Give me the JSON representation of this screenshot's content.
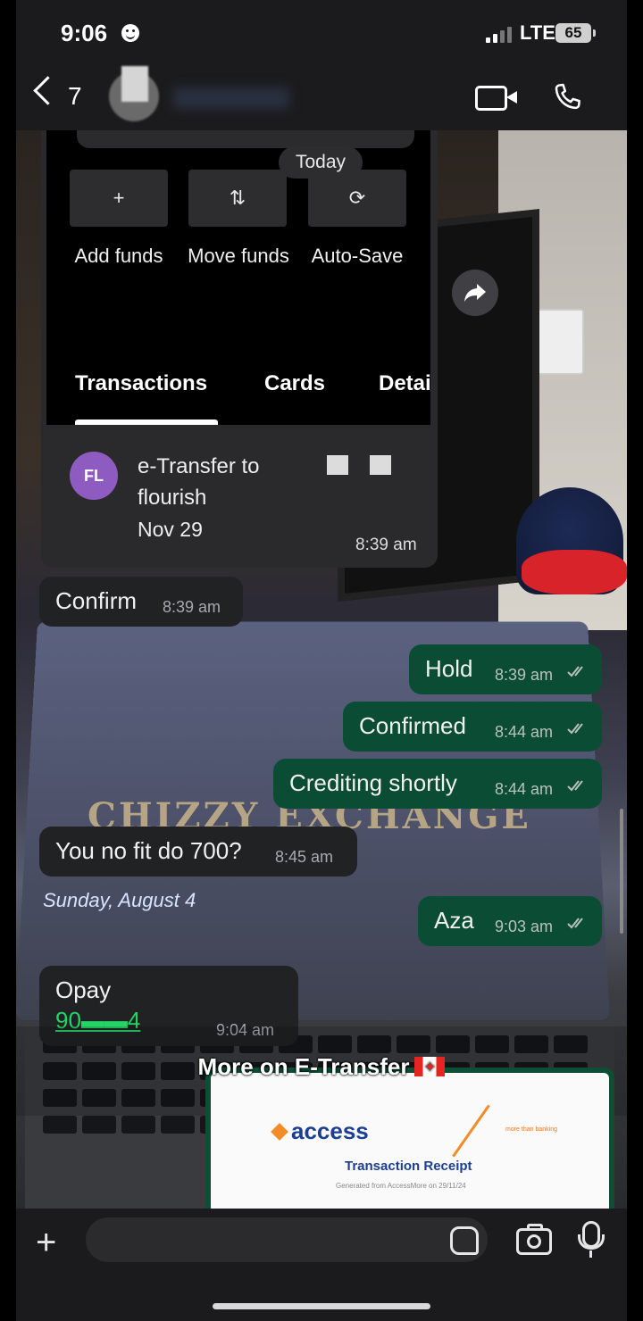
{
  "status_bar": {
    "time": "9:06",
    "network": "LTE",
    "battery": "65"
  },
  "header": {
    "back_count": "7"
  },
  "screenshot": {
    "quick_actions": [
      {
        "icon": "+",
        "label": "Add funds",
        "icon_name": "add-icon"
      },
      {
        "icon": "⇅",
        "label": "Move funds",
        "icon_name": "transfer-icon"
      },
      {
        "icon": "⟳",
        "label": "Auto-Save",
        "icon_name": "auto-save-icon"
      }
    ],
    "date_divider": "Today",
    "tabs": [
      "Transactions",
      "Cards",
      "Detai"
    ],
    "transaction": {
      "initials": "FL",
      "title": "e-Transfer to flourish",
      "date": "Nov 29"
    },
    "time": "8:39 am"
  },
  "messages": [
    {
      "dir": "in",
      "text": "Confirm",
      "time": "8:39 am"
    },
    {
      "dir": "out",
      "text": "Hold",
      "time": "8:39 am"
    },
    {
      "dir": "out",
      "text": "Confirmed",
      "time": "8:44 am"
    },
    {
      "dir": "out",
      "text": "Crediting shortly",
      "time": "8:44 am"
    },
    {
      "dir": "in",
      "text": "You no fit do 700?",
      "time": "8:45 am"
    },
    {
      "dir": "out",
      "text": "Aza",
      "time": "9:03 am"
    },
    {
      "dir": "in",
      "text": "Opay",
      "time": "9:04 am",
      "account": "90▬▬4"
    }
  ],
  "background": {
    "brand_text": "CHIZZY EXCHANGE",
    "date_text": "Sunday, August 4"
  },
  "story_caption": "More on E-Transfer",
  "receipt": {
    "logo": "access",
    "title": "Transaction Receipt",
    "tag": "more than banking",
    "generated": "Generated from AccessMore on 29/11/24"
  },
  "colors": {
    "outgoing_bubble": "#0b4d34",
    "incoming_bubble": "#202224",
    "accent_green": "#25d366",
    "avatar_purple": "#8e5bc0"
  }
}
